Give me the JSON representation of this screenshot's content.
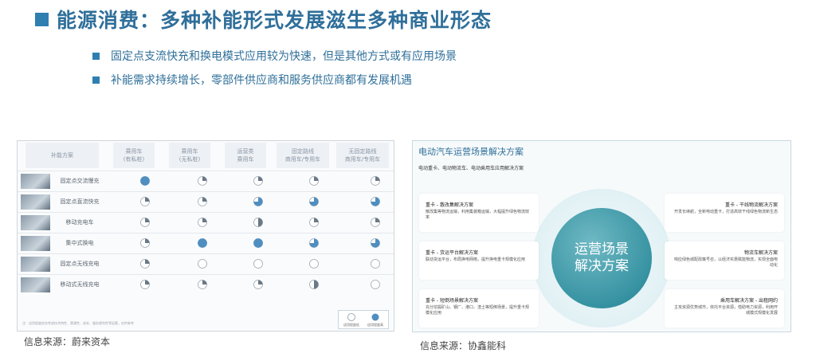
{
  "title": "能源消费：多种补能形式发展滋生多种商业形态",
  "bullets": [
    "固定点支流快充和换电模式应用较为快速，但是其他方式或有应用场景",
    "补能需求持续增长，零部件供应商和服务供应商都有发展机遇"
  ],
  "left_table": {
    "headers": [
      "补能方案",
      "乘用车\n(有私桩)",
      "乘用车\n(无私桩)",
      "运营类\n乘用车",
      "固定路线\n商用车/专用车",
      "无固定路线\n商用车/专用车"
    ],
    "rows": [
      {
        "label": "固定点交流慢充",
        "levels": [
          1,
          0.25,
          0.25,
          0.25,
          0.25
        ]
      },
      {
        "label": "固定点直流快充",
        "levels": [
          0.25,
          0.25,
          0.75,
          0.75,
          0.75
        ]
      },
      {
        "label": "移动充电车",
        "levels": [
          0.25,
          0.25,
          0.5,
          0.25,
          0.25
        ]
      },
      {
        "label": "集中式换电",
        "levels": [
          0.25,
          1,
          1,
          0.75,
          0.75
        ]
      },
      {
        "label": "固定点无线充电",
        "levels": [
          0.25,
          0,
          0,
          0,
          0
        ]
      },
      {
        "label": "移动式无线充电",
        "levels": [
          0.25,
          0.25,
          0.25,
          0.5,
          0
        ]
      }
    ],
    "legend": [
      "适用程度低",
      "适用程度高"
    ],
    "footnote": "注：适用程度综合考虑技术特性、营建性、成本、服务便利性等因素，仅供参考"
  },
  "right_box": {
    "title": "电动汽车运营场景解决方案",
    "subtitle": "电动重卡、电动物流车、电动乘用车应用解决方案",
    "center": "运营场景\n解决方案",
    "cards": [
      {
        "title": "重卡 - 散改集解决方案",
        "desc": "散改集等物流运输，利用集装箱运输，大幅提升绿色物流效率",
        "side": "L"
      },
      {
        "title": "重卡 - 干线物流解决方案",
        "desc": "开发长续航，全新电动重卡，打造高效干线绿色物流新生态",
        "side": "R"
      },
      {
        "title": "重卡 - 货运平台解决方案",
        "desc": "联动货运平台，布局换电网络，提升换电重卡规模化应用",
        "side": "L"
      },
      {
        "title": "物流车解决方案",
        "desc": "响应绿色城配政策号召，以经济实惠赋能物流，实现全面电动化",
        "side": "R"
      },
      {
        "title": "重卡 - 短倒场景解决方案",
        "desc": "充分挖掘矿山、钢厂、港口、渣土等短倒场景，提升重卡规模化应用",
        "side": "L"
      },
      {
        "title": "乘用车解决方案 - 出租网约",
        "desc": "主攻资源优势城市，依托平台资源，借助电力资源，利用开城模式规模化发展",
        "side": "R"
      }
    ]
  },
  "sources": [
    "信息来源：蔚来资本",
    "信息来源：协鑫能科"
  ]
}
